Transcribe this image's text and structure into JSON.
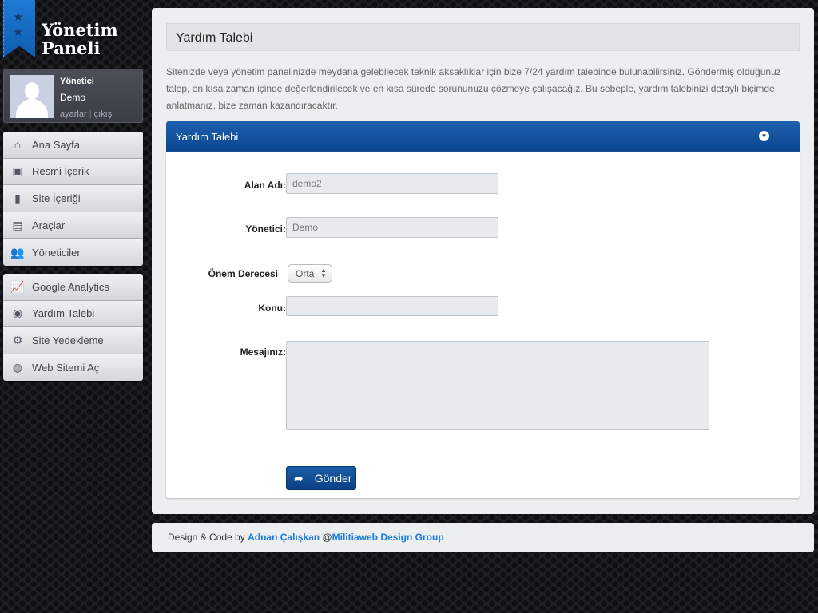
{
  "logo": {
    "line1": "Yönetim",
    "line2": "Paneli"
  },
  "user": {
    "role": "Yönetici",
    "name": "Demo",
    "settings": "ayarlar",
    "separator": "|",
    "logout": "çıkış"
  },
  "menu": {
    "group1": [
      {
        "label": "Ana Sayfa",
        "icon": "home-icon"
      },
      {
        "label": "Resmi İçerik",
        "icon": "pdf-icon"
      },
      {
        "label": "Site İçeriği",
        "icon": "document-icon"
      },
      {
        "label": "Araçlar",
        "icon": "image-icon"
      },
      {
        "label": "Yöneticiler",
        "icon": "users-icon"
      }
    ],
    "group2": [
      {
        "label": "Google Analytics",
        "icon": "chart-icon"
      },
      {
        "label": "Yardım Talebi",
        "icon": "lifebuoy-icon"
      },
      {
        "label": "Site Yedekleme",
        "icon": "gears-icon"
      },
      {
        "label": "Web Sitemi Aç",
        "icon": "globe-icon"
      }
    ]
  },
  "page": {
    "title": "Yardım Talebi",
    "description": "Sitenizde veya yönetim panelinizde meydana gelebilecek teknik aksaklıklar için bize 7/24 yardım talebinde bulunabilirsiniz. Göndermiş olduğunuz talep, en kısa zaman içinde değerlendirilecek ve en kısa sürede sorununuzu çözmeye çalışacağız. Bu sebeple, yardım talebinizi detaylı biçimde anlatmanız, bize zaman kazandıracaktır."
  },
  "form": {
    "panel_title": "Yardım Talebi",
    "domain_label": "Alan Adı:",
    "domain_value": "demo2",
    "admin_label": "Yönetici:",
    "admin_value": "Demo",
    "priority_label": "Önem Derecesi",
    "priority_value": "Orta",
    "subject_label": "Konu:",
    "subject_value": "",
    "message_label": "Mesajınız:",
    "message_value": "",
    "submit": "Gönder"
  },
  "footer": {
    "prefix": "Design & Code by",
    "author": "Adnan Çalışkan",
    "at": "@",
    "group": "Militiaweb Design Group"
  },
  "colors": {
    "accent": "#0b4690",
    "link": "#1a7be0"
  }
}
